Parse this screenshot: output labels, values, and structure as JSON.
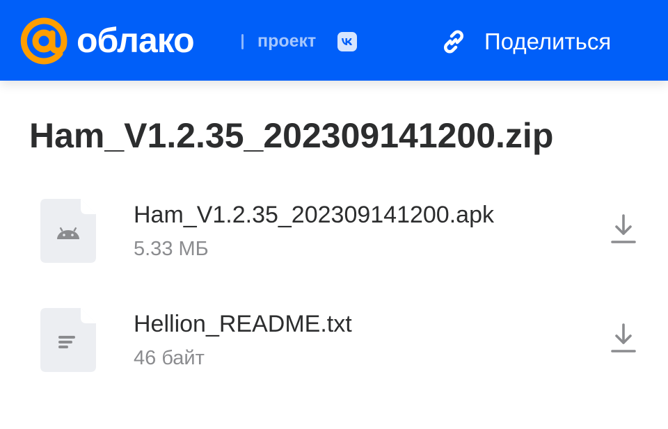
{
  "header": {
    "logo_text": "облако",
    "project_text": "проект",
    "share_label": "Поделиться",
    "colors": {
      "background": "#005ff9",
      "logo_accent": "#ff9e00"
    }
  },
  "archive": {
    "title": "Ham_V1.2.35_202309141200.zip"
  },
  "files": [
    {
      "name": "Ham_V1.2.35_202309141200.apk",
      "size": "5.33 МБ",
      "icon": "android-icon"
    },
    {
      "name": "Hellion_README.txt",
      "size": "46 байт",
      "icon": "text-file-icon"
    }
  ]
}
